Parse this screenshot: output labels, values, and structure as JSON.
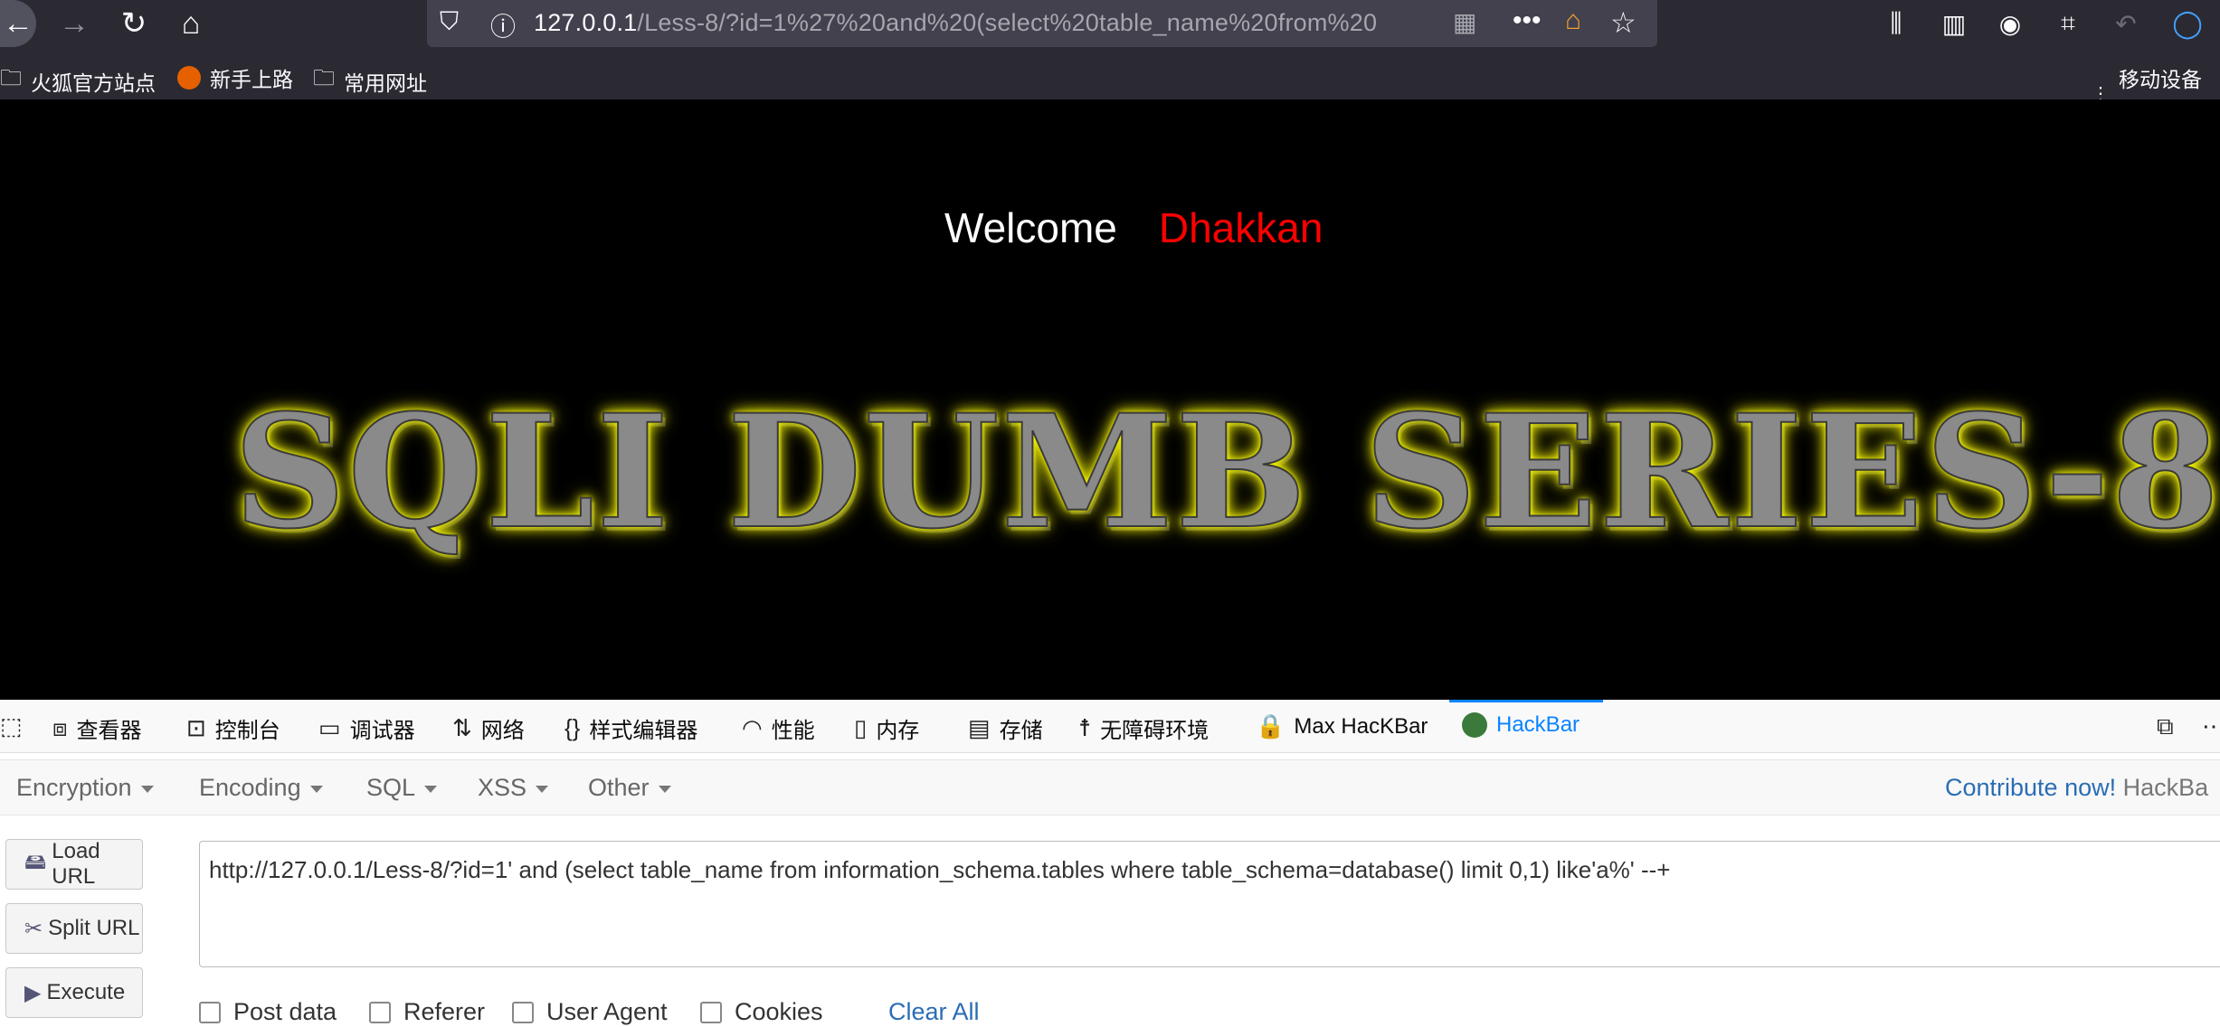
{
  "browser": {
    "url_host": "127.0.0.1",
    "url_rest": "/Less-8/?id=1%27%20and%20(select%20table_name%20from%20",
    "bookmarks": [
      {
        "label": "火狐官方站点",
        "icon": "folder-icon"
      },
      {
        "label": "新手上路",
        "icon": "firefox-icon"
      },
      {
        "label": "常用网址",
        "icon": "folder-icon"
      }
    ],
    "mobile_bookmarks": "移动设备上的"
  },
  "page": {
    "welcome": "Welcome",
    "name": "Dhakkan",
    "banner": "SQLI DUMB SERIES-8"
  },
  "devtools": {
    "tabs": [
      {
        "label": "查看器",
        "icon": "inspector-icon"
      },
      {
        "label": "控制台",
        "icon": "console-icon"
      },
      {
        "label": "调试器",
        "icon": "debugger-icon"
      },
      {
        "label": "网络",
        "icon": "network-icon"
      },
      {
        "label": "样式编辑器",
        "icon": "style-editor-icon"
      },
      {
        "label": "性能",
        "icon": "performance-icon"
      },
      {
        "label": "内存",
        "icon": "memory-icon"
      },
      {
        "label": "存储",
        "icon": "storage-icon"
      },
      {
        "label": "无障碍环境",
        "icon": "accessibility-icon"
      },
      {
        "label": "Max HacKBar",
        "icon": "max-hackbar-icon"
      },
      {
        "label": "HackBar",
        "icon": "hackbar-icon"
      }
    ],
    "active_color": "#0a84ff"
  },
  "hackbar": {
    "menus": [
      "Encryption",
      "Encoding",
      "SQL",
      "XSS",
      "Other"
    ],
    "contribute": "Contribute now!",
    "contribute_suffix": "HackBa",
    "buttons": {
      "load": "Load URL",
      "split": "Split URL",
      "execute": "Execute"
    },
    "url_value": "http://127.0.0.1/Less-8/?id=1' and (select table_name from information_schema.tables where table_schema=database() limit 0,1) like'a%' --+",
    "options": [
      "Post data",
      "Referer",
      "User Agent",
      "Cookies"
    ],
    "clear_all": "Clear All"
  }
}
